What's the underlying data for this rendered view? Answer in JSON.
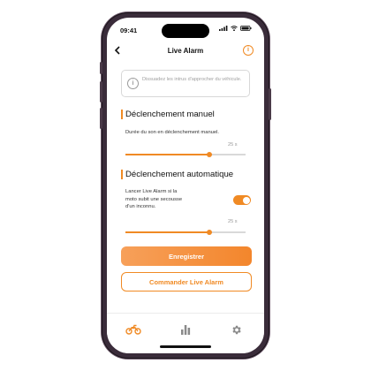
{
  "status_bar": {
    "time": "09:41"
  },
  "header": {
    "title": "Live Alarm",
    "back_icon": "chevron-left-icon",
    "info_icon": "info-icon"
  },
  "info_notice": {
    "text": "Dissuadez les intrus d'approcher du véhicule."
  },
  "manual": {
    "title": "Déclenchement manuel",
    "description": "Durée du son en déclenchement manuel.",
    "duration_label": "25 s",
    "duration_fraction": 0.7
  },
  "automatic": {
    "title": "Déclenchement automatique",
    "description_lines": [
      "Lancer Live Alarm si la",
      "moto subit une secousse",
      "d'un inconnu."
    ],
    "toggle_on": true,
    "duration_label": "25 s",
    "duration_fraction": 0.7
  },
  "buttons": {
    "save": "Enregistrer",
    "order": "Commander Live Alarm"
  },
  "tabbar": {
    "items": [
      "motorcycle-icon",
      "bar-chart-icon",
      "gear-icon"
    ],
    "active_index": 0
  },
  "colors": {
    "accent": "#f08a24",
    "inactive": "#8a8a8a"
  }
}
